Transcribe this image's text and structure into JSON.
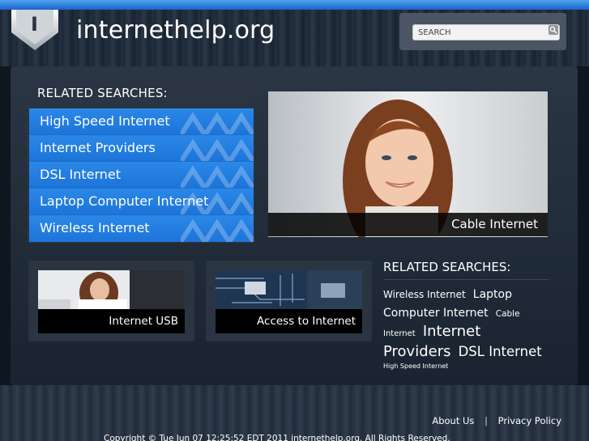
{
  "header": {
    "site_name": "internethelp.org",
    "logo_letter": "I",
    "search_placeholder": "SEARCH"
  },
  "related_searches": {
    "title": "RELATED SEARCHES:",
    "items": [
      {
        "label": "High Speed Internet"
      },
      {
        "label": "Internet Providers"
      },
      {
        "label": "DSL Internet"
      },
      {
        "label": "Laptop Computer Internet"
      },
      {
        "label": "Wireless Internet"
      }
    ]
  },
  "hero": {
    "caption": "Cable Internet"
  },
  "cards": [
    {
      "caption": "Internet USB"
    },
    {
      "caption": "Access to Internet"
    }
  ],
  "related_searches_2": {
    "title": "RELATED SEARCHES:",
    "tags": [
      {
        "label": "Wireless Internet",
        "size": "sm"
      },
      {
        "label": "Laptop",
        "size": "md"
      },
      {
        "label": "Computer Internet",
        "size": "md"
      },
      {
        "label": "Cable",
        "size": "xs"
      },
      {
        "label": "Internet",
        "size": "xs"
      },
      {
        "label": "Internet",
        "size": "lg"
      },
      {
        "label": "Providers",
        "size": "lg"
      },
      {
        "label": "DSL Internet",
        "size": "lg2"
      },
      {
        "label": "High Speed Internet",
        "size": "xxs"
      }
    ]
  },
  "footer": {
    "about": "About Us",
    "separator": "|",
    "privacy": "Privacy Policy",
    "copyright": "Copyright © Tue Jun 07 12:25:52 EDT 2011 internethelp.org. All Rights Reserved."
  },
  "colors": {
    "accent_blue": "#1f7fe0",
    "top_bar": "#2f7fe0",
    "background": "#0e1620"
  }
}
